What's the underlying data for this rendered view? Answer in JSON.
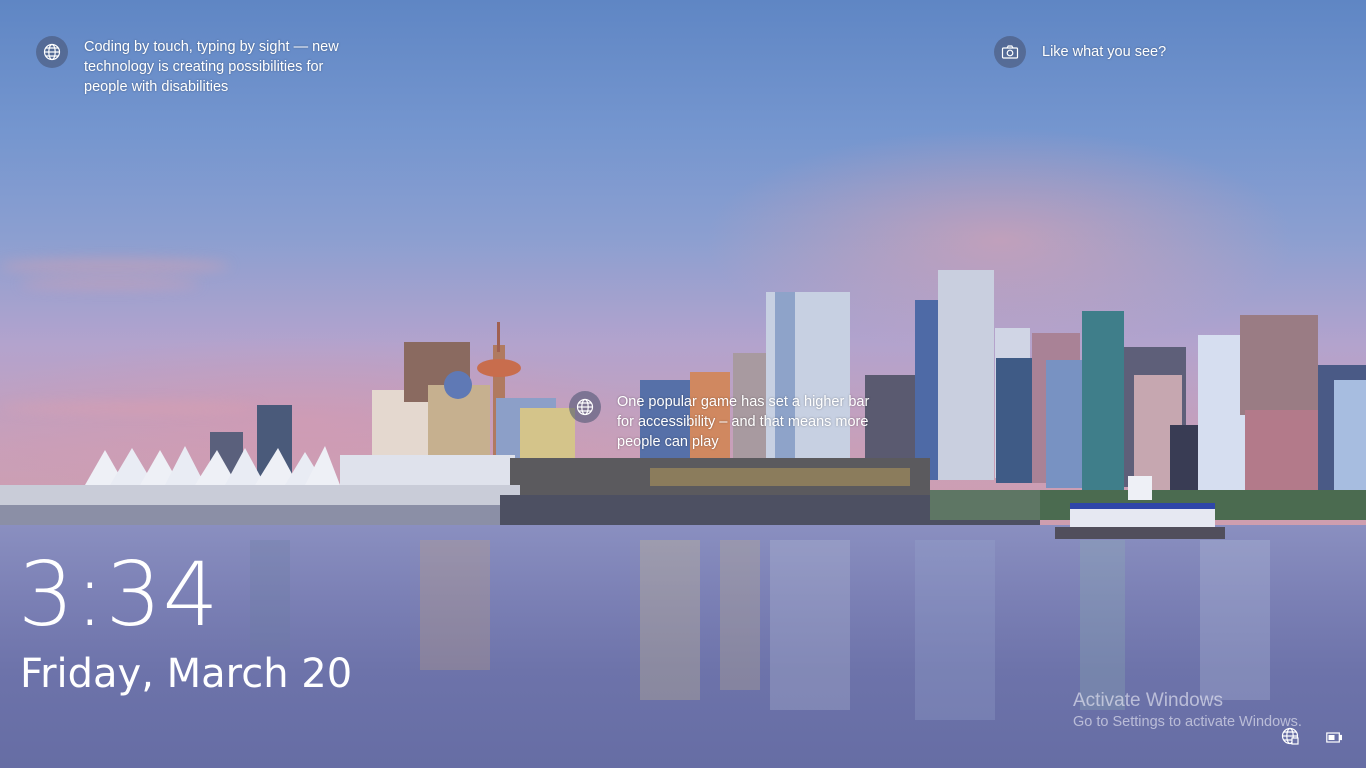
{
  "lock_screen": {
    "news_1": {
      "icon": "globe-icon",
      "lines": [
        "Coding by touch, typing by sight — new",
        "technology is creating possibilities for",
        "people with disabilities"
      ]
    },
    "news_2": {
      "icon": "camera-icon",
      "text": "Like what you see?"
    },
    "news_3": {
      "icon": "globe-icon",
      "lines": [
        "One popular game has set a higher bar",
        "for accessibility – and that means more",
        "people can play"
      ]
    },
    "clock": {
      "time": "3:34",
      "date": "Friday, March 20"
    },
    "watermark": {
      "title": "Activate Windows",
      "subtitle": "Go to Settings to activate Windows."
    },
    "tray": {
      "network_icon": "network-globe-icon",
      "battery_icon": "battery-icon"
    }
  }
}
